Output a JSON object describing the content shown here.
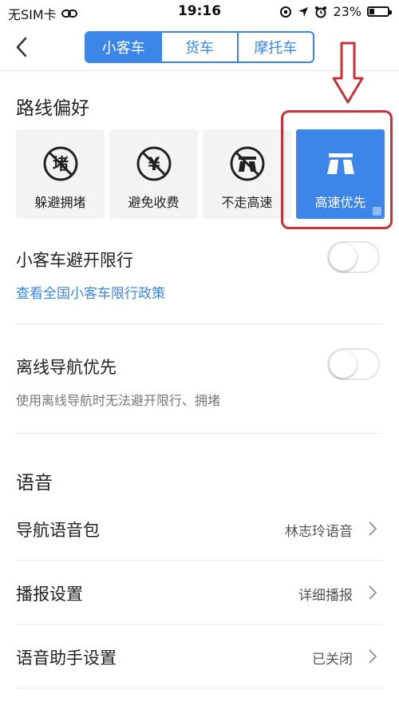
{
  "status_bar": {
    "carrier": "无SIM卡",
    "time": "19:16",
    "battery": "23%",
    "battery_level": 0.23
  },
  "nav": {
    "tabs": [
      {
        "label": "小客车",
        "active": true
      },
      {
        "label": "货车",
        "active": false
      },
      {
        "label": "摩托车",
        "active": false
      }
    ]
  },
  "route_pref": {
    "title": "路线偏好",
    "options": [
      {
        "label": "躲避拥堵",
        "icon": "avoid-congestion-icon",
        "selected": false
      },
      {
        "label": "避免收费",
        "icon": "avoid-toll-icon",
        "selected": false
      },
      {
        "label": "不走高速",
        "icon": "no-highway-icon",
        "selected": false
      },
      {
        "label": "高速优先",
        "icon": "highway-icon",
        "selected": true
      }
    ]
  },
  "restriction": {
    "label": "小客车避开限行",
    "link": "查看全国小客车限行政策",
    "enabled": false
  },
  "offline": {
    "label": "离线导航优先",
    "note": "使用离线导航时无法避开限行、拥堵",
    "enabled": false
  },
  "voice": {
    "title": "语音",
    "items": [
      {
        "label": "导航语音包",
        "value": "林志玲语音"
      },
      {
        "label": "播报设置",
        "value": "详细播报"
      },
      {
        "label": "语音助手设置",
        "value": "已关闭"
      }
    ]
  },
  "colors": {
    "accent": "#3b86e8",
    "highlight": "#c9313a"
  }
}
